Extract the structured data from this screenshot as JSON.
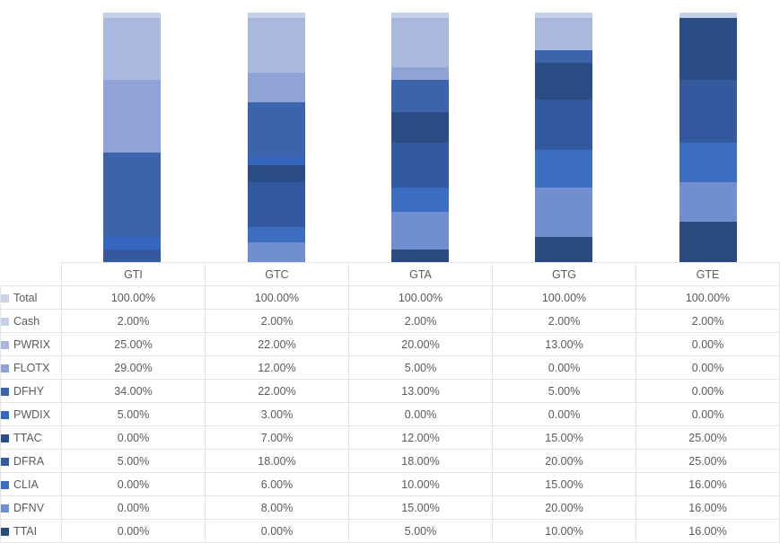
{
  "chart_data": {
    "type": "bar",
    "subtype": "stacked-column-100-percent",
    "title": "",
    "xlabel": "",
    "ylabel": "",
    "grid": false,
    "legend_position": "table-left-column",
    "ylim": [
      0,
      100
    ],
    "categories": [
      "GTI",
      "GTC",
      "GTA",
      "GTG",
      "GTE"
    ],
    "series": [
      {
        "name": "Total",
        "color": "#ccd3e8",
        "values": [
          100.0,
          100.0,
          100.0,
          100.0,
          100.0
        ],
        "display": [
          "100.00%",
          "100.00%",
          "100.00%",
          "100.00%",
          "100.00%"
        ],
        "plotted": false
      },
      {
        "name": "Cash",
        "color": "#c5cfe8",
        "values": [
          2.0,
          2.0,
          2.0,
          2.0,
          2.0
        ],
        "display": [
          "2.00%",
          "2.00%",
          "2.00%",
          "2.00%",
          "2.00%"
        ],
        "plotted": true
      },
      {
        "name": "PWRIX",
        "color": "#aab8dd",
        "values": [
          25.0,
          22.0,
          20.0,
          13.0,
          0.0
        ],
        "display": [
          "25.00%",
          "22.00%",
          "20.00%",
          "13.00%",
          "0.00%"
        ],
        "plotted": true
      },
      {
        "name": "FLOTX",
        "color": "#8fa3d6",
        "values": [
          29.0,
          12.0,
          5.0,
          0.0,
          0.0
        ],
        "display": [
          "29.00%",
          "12.00%",
          "5.00%",
          "0.00%",
          "0.00%"
        ],
        "plotted": true
      },
      {
        "name": "DFHY",
        "color": "#3b64ab",
        "values": [
          34.0,
          22.0,
          13.0,
          5.0,
          0.0
        ],
        "display": [
          "34.00%",
          "22.00%",
          "13.00%",
          "5.00%",
          "0.00%"
        ],
        "plotted": true
      },
      {
        "name": "PWDIX",
        "color": "#3567c0",
        "values": [
          5.0,
          3.0,
          0.0,
          0.0,
          0.0
        ],
        "display": [
          "5.00%",
          "3.00%",
          "0.00%",
          "0.00%",
          "0.00%"
        ],
        "plotted": true
      },
      {
        "name": "TTAC",
        "color": "#2b4d86",
        "values": [
          0.0,
          7.0,
          12.0,
          15.0,
          25.0
        ],
        "display": [
          "0.00%",
          "7.00%",
          "12.00%",
          "15.00%",
          "25.00%"
        ],
        "plotted": true
      },
      {
        "name": "DFRA",
        "color": "#35599f",
        "values": [
          5.0,
          18.0,
          18.0,
          20.0,
          25.0
        ],
        "display": [
          "5.00%",
          "18.00%",
          "18.00%",
          "20.00%",
          "25.00%"
        ],
        "plotted": true
      },
      {
        "name": "CLIA",
        "color": "#3b6ec0",
        "values": [
          0.0,
          6.0,
          10.0,
          15.0,
          16.0
        ],
        "display": [
          "0.00%",
          "6.00%",
          "10.00%",
          "15.00%",
          "16.00%"
        ],
        "plotted": true
      },
      {
        "name": "DFNV",
        "color": "#718ed1",
        "values": [
          0.0,
          8.0,
          15.0,
          20.0,
          16.0
        ],
        "display": [
          "0.00%",
          "8.00%",
          "15.00%",
          "20.00%",
          "16.00%"
        ],
        "plotted": true
      },
      {
        "name": "TTAI",
        "color": "#2b4a80",
        "values": [
          0.0,
          0.0,
          5.0,
          10.0,
          16.0
        ],
        "display": [
          "0.00%",
          "0.00%",
          "5.00%",
          "10.00%",
          "16.00%"
        ],
        "plotted": true
      }
    ]
  },
  "table": {
    "corner_label": "",
    "column_headers": [
      "GTI",
      "GTC",
      "GTA",
      "GTG",
      "GTE"
    ],
    "rows": [
      {
        "label": "Total",
        "swatch": "#ccd3e8",
        "values": [
          "100.00%",
          "100.00%",
          "100.00%",
          "100.00%",
          "100.00%"
        ]
      },
      {
        "label": "Cash",
        "swatch": "#c5cfe8",
        "values": [
          "2.00%",
          "2.00%",
          "2.00%",
          "2.00%",
          "2.00%"
        ]
      },
      {
        "label": "PWRIX",
        "swatch": "#aab8dd",
        "values": [
          "25.00%",
          "22.00%",
          "20.00%",
          "13.00%",
          "0.00%"
        ]
      },
      {
        "label": "FLOTX",
        "swatch": "#8fa3d6",
        "values": [
          "29.00%",
          "12.00%",
          "5.00%",
          "0.00%",
          "0.00%"
        ]
      },
      {
        "label": "DFHY",
        "swatch": "#3b64ab",
        "values": [
          "34.00%",
          "22.00%",
          "13.00%",
          "5.00%",
          "0.00%"
        ]
      },
      {
        "label": "PWDIX",
        "swatch": "#3567c0",
        "values": [
          "5.00%",
          "3.00%",
          "0.00%",
          "0.00%",
          "0.00%"
        ]
      },
      {
        "label": "TTAC",
        "swatch": "#2b4d86",
        "values": [
          "0.00%",
          "7.00%",
          "12.00%",
          "15.00%",
          "25.00%"
        ]
      },
      {
        "label": "DFRA",
        "swatch": "#35599f",
        "values": [
          "5.00%",
          "18.00%",
          "18.00%",
          "20.00%",
          "25.00%"
        ]
      },
      {
        "label": "CLIA",
        "swatch": "#3b6ec0",
        "values": [
          "0.00%",
          "6.00%",
          "10.00%",
          "15.00%",
          "16.00%"
        ]
      },
      {
        "label": "DFNV",
        "swatch": "#718ed1",
        "values": [
          "0.00%",
          "8.00%",
          "15.00%",
          "20.00%",
          "16.00%"
        ]
      },
      {
        "label": "TTAI",
        "swatch": "#2b4a80",
        "values": [
          "0.00%",
          "0.00%",
          "5.00%",
          "10.00%",
          "16.00%"
        ]
      }
    ]
  }
}
